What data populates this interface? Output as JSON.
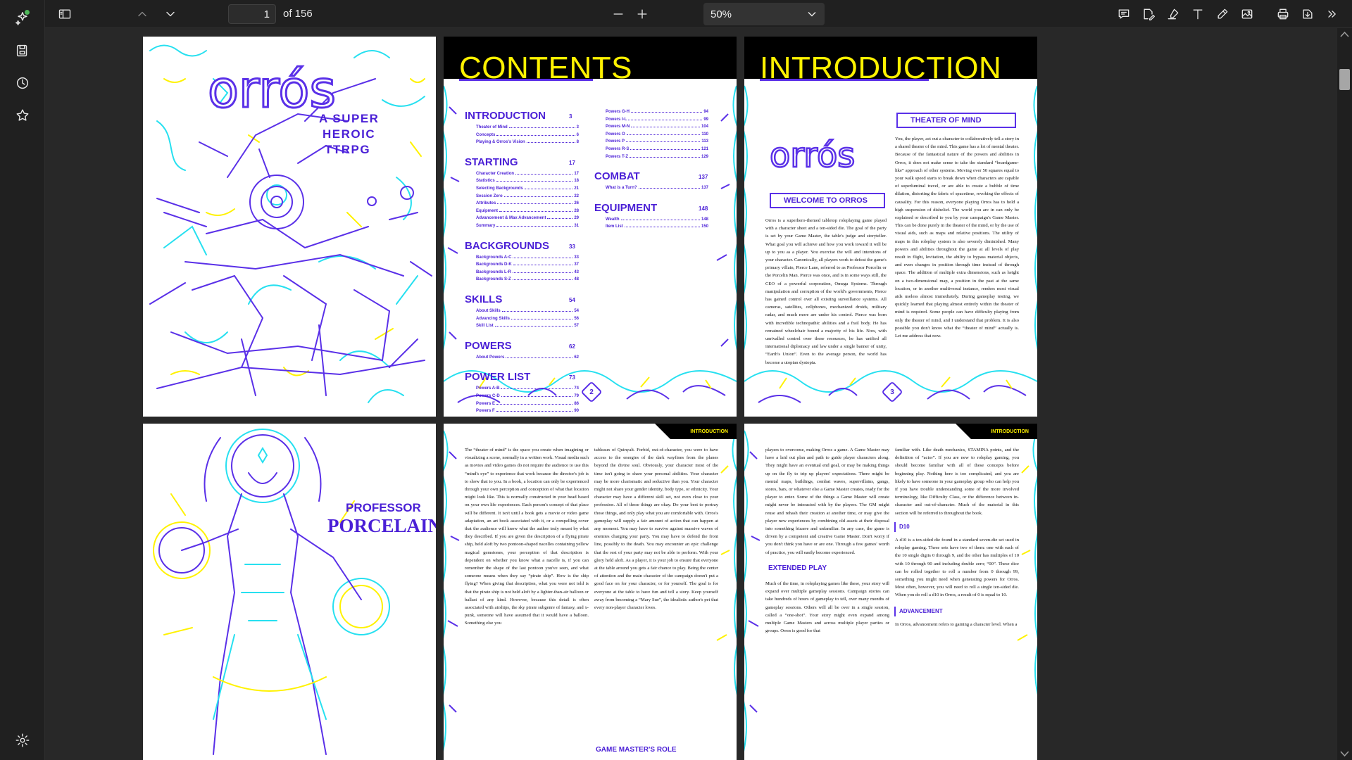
{
  "toolbar": {
    "current_page": "1",
    "page_count": "of 156",
    "zoom": "50%",
    "zoom_out": "−",
    "zoom_in": "+"
  },
  "rail": {
    "items": [
      "copilot-icon",
      "save-icon",
      "history-icon",
      "favorites-icon",
      "settings-icon"
    ]
  },
  "tools": [
    "comment-icon",
    "edit-text-icon",
    "highlight-icon",
    "text-icon",
    "draw-icon",
    "image-icon",
    "print-icon",
    "save-as-icon",
    "more-icon"
  ],
  "cover": {
    "title": "orrós",
    "subtitle": [
      "A SUPER",
      "HEROIC",
      "TTRPG"
    ]
  },
  "contents": {
    "title": "CONTENTS",
    "sections": [
      {
        "name": "INTRODUCTION",
        "page": "3",
        "items": [
          [
            "Theater of Mind",
            "3"
          ],
          [
            "Concepts",
            "6"
          ],
          [
            "Playing & Orros's Vision",
            "8"
          ]
        ]
      },
      {
        "name": "STARTING",
        "page": "17",
        "items": [
          [
            "Character Creation",
            "17"
          ],
          [
            "Statistics",
            "18"
          ],
          [
            "Selecting Backgrounds",
            "21"
          ],
          [
            "Session Zero",
            "22"
          ],
          [
            "Attributes",
            "26"
          ],
          [
            "Equipment",
            "28"
          ],
          [
            "Advancement & Max Advancement",
            "29"
          ],
          [
            "Summary",
            "31"
          ]
        ]
      },
      {
        "name": "BACKGROUNDS",
        "page": "33",
        "items": [
          [
            "Backgrounds A-C",
            "33"
          ],
          [
            "Backgrounds D-K",
            "37"
          ],
          [
            "Backgrounds L-R",
            "43"
          ],
          [
            "Backgrounds S-Z",
            "48"
          ]
        ]
      },
      {
        "name": "SKILLS",
        "page": "54",
        "items": [
          [
            "About Skills",
            "54"
          ],
          [
            "Advancing Skills",
            "56"
          ],
          [
            "Skill List",
            "57"
          ]
        ]
      },
      {
        "name": "POWERS",
        "page": "62",
        "items": [
          [
            "About Powers",
            "62"
          ]
        ]
      },
      {
        "name": "POWER LIST",
        "page": "73",
        "items": [
          [
            "Powers A-B",
            "74"
          ],
          [
            "Powers C-D",
            "79"
          ],
          [
            "Powers E",
            "86"
          ],
          [
            "Powers F",
            "90"
          ]
        ]
      }
    ],
    "sections_right": [
      {
        "name": "",
        "page": "",
        "items": [
          [
            "Powers G-H",
            "94"
          ],
          [
            "Powers I-L",
            "99"
          ],
          [
            "Powers M-N",
            "104"
          ],
          [
            "Powers O",
            "110"
          ],
          [
            "Powers P",
            "113"
          ],
          [
            "Powers R-S",
            "121"
          ],
          [
            "Powers T-Z",
            "129"
          ]
        ]
      },
      {
        "name": "COMBAT",
        "page": "137",
        "items": [
          [
            "What is a Turn?",
            "137"
          ]
        ]
      },
      {
        "name": "EQUIPMENT",
        "page": "148",
        "items": [
          [
            "Wealth",
            "148"
          ],
          [
            "Item List",
            "150"
          ]
        ]
      }
    ],
    "page_number": "2"
  },
  "introduction": {
    "title": "INTRODUCTION",
    "logo": "orrós",
    "welcome": "WELCOME TO ORROS",
    "theater": "THEATER OF MIND",
    "left_text": "Orros is a superhero-themed tabletop roleplaying game played with a character sheet and a ten-sided die. The goal of the party is set by your Game Master, the table's judge and storyteller. What goal you will achieve and how you work toward it will be up to you as a player. You exercise the will and intentions of your character. Canonically, all players work to defeat the game's primary villain, Pierce Lane, referred to as Professor Porcelin or the Porcelin Man. Pierce was once, and is in some ways still, the CEO of a powerful corporation, Omega Systems. Through manipulation and corruption of the world's governments, Pierce has gained control over all existing surveillance systems. All cameras, satellites, cellphones, mechanized droids, military radar, and much more are under his control. Pierce was born with incredible technopathic abilities and a frail body. He has remained wheelchair bound a majority of his life. Now, with unrivalled control over these resources, he has unified all international diplomacy and law under a single banner of unity, “Earth's Union”. Even to the average person, the world has become a utopian dystopia.",
    "right_text": "You, the player, act out a character to collaboratively tell a story in a shared theater of the mind. This game has a lot of mental theater. Because of the fantastical nature of the powers and abilities in Orros, it does not make sense to take the standard “boardgame-like” approach of other systems. Moving over 50 squares equal to your walk speed starts to break down when characters are capable of superluminal travel, or are able to create a bubble of time dilation, distorting the fabric of spacetime, revoking the effects of causality. For this reason, everyone playing Orros has to hold a high suspension of disbelief. The world you are in can only be explained or described to you by your campaign's Game Master. This can be done purely in the theater of the mind, or by the use of visual aids, such as maps and relative positions. The utility of maps in this roleplay system is also severely diminished. Many powers and abilities throughout the game at all levels of play result in flight, levitation, the ability to bypass material objects, and even changes in position through time instead of through space. The addition of multiple extra dimensions, such as height on a two-dimensional map, a position in the past at the same location, or in another multiversal instance, renders most visual aids useless almost immediately. During gameplay testing, we quickly learned that playing almost entirely within the theater of mind is required. Some people can have difficulty playing from only the theater of mind, and I understand that problem. It is also possible you don't know what the “theater of mind” actually is. Let me address that now.",
    "page_number": "3"
  },
  "porcelain": {
    "line1": "PROFESSOR",
    "line2": "PORCELAIN"
  },
  "page4": {
    "tag": "INTRODUCTION",
    "col1": "The “theater of mind” is the space you create when imagining or visualizing a scene, normally in a written work. Visual media such as movies and video games do not require the audience to use this “mind's eye” to experience that work because the director's job is to show that to you. In a book, a location can only be experienced through your own perception and conception of what that location might look like. This is normally constructed in your head based on your own life experiences. Each person's concept of that place will be different. It isn't until a book gets a movie or video game adaptation, an art book associated with it, or a compelling cover that the audience will know what the author truly meant by what they described. If you are given the description of a flying pirate ship, held aloft by two pontoon-shaped nacelles containing yellow magical gemstones, your perception of that description is dependent on whether you know what a nacelle is, if you can remember the shape of the last pontoon you've seen, and what someone means when they say “pirate ship”. How is the ship flying? When giving that description, what you were not told is that the pirate ship is not held aloft by a lighter-than-air balloon or ballast of any kind. However, because this detail is often associated with airships, the sky pirate subgenre of fantasy, and x-punk, someone will have assumed that it would have a balloon. Something else you",
    "col2": "tableaux of Quinyalt. Forbid, out-of-character, you were to have access to the energies of the dark wayfines from the planes beyond the divine soul. Obviously, your character most of the time isn't going to share your personal abilities. Your character may be more charismatic and seductive than you. Your character might not share your gender identity, body type, or ethnicity. Your character may have a different skill set, not even close to your profession. All of those things are okay. Do your best to portray those things, and only play what you are comfortable with. Orros's gameplay will supply a fair amount of action that can happen at any moment. You may have to survive against massive waves of enemies charging your party. You may have to defend the front line, possibly to the death. You may encounter an epic challenge that the rest of your party may not be able to perform. With your glory held aloft. As a player, it is your job to ensure that everyone at the table around you gets a fair chance to play. Being the center of attention and the main character of the campaign doesn't put a good face on for your character, or for yourself. The goal is for everyone at the table to have fun and tell a story. Keep yourself away from becoming a “Mary Sue”, the idealistic author's pet that every non-player character loves.",
    "subhead": "GAME MASTER'S ROLE"
  },
  "page5": {
    "tag": "INTRODUCTION",
    "col1": "players to overcome, making Orros a game. A Game Master may have a laid out plan and path to guide player characters along. They might have an eventual end goal, or may be making things up on the fly to trip up players' expectations. There might be mental maps, buildings, combat waves, supervillains, gangs, stores, bars, or whatever else a Game Master creates, ready for the player to enter. Some of the things a Game Master will create might never be interacted with by the players. The GM might reuse and rehash their creation at another time, or may give the player new experiences by combining old assets at their disposal into something bizarre and unfamiliar. In any case, the game is driven by a competent and creative Game Master. Don't worry if you don't think you have or are one. Through a few games' worth of practice, you will easily become experienced.",
    "extended": "EXTENDED PLAY",
    "col1b": "Much of the time, in roleplaying games like these, your story will expand over multiple gameplay sessions. Campaign stories can take hundreds of hours of gameplay to tell, over many months of gameplay sessions. Others will all be over in a single session, called a “one-shot”. Your story might even expand among multiple Game Masters and across multiple player parties or groups. Orros is good for that",
    "col2": "familiar with. Like death mechanics, STAMINA points, and the definition of “actor”. If you are new to roleplay gaming, you should become familiar with all of these concepts before beginning play. Nothing here is too complicated, and you are likely to have someone in your gameplay group who can help you if you have trouble understanding some of the more involved terminology, like Difficulty Class, or the difference between in-character and out-of-character. Much of the material in this section will be referred to throughout the book.",
    "d10": "D10",
    "col2b": "A d10 is a ten-sided die found in a standard seven-die set used in roleplay gaming. These sets have two of them: one with each of the 10 single digits 0 through 9, and the other has multiples of 10 with 10 through 90 and including double zero; “00”. These dice can be rolled together to roll a number from 0 through 99, something you might need when generating powers for Orros. Most often, however, you will need to roll a single ten-sided die. When you do roll a d10 in Orros, a result of 0 is equal to 10.",
    "advancement": "ADVANCEMENT",
    "col2c": "In Orros, advancement refers to gaining a character level. When a"
  }
}
